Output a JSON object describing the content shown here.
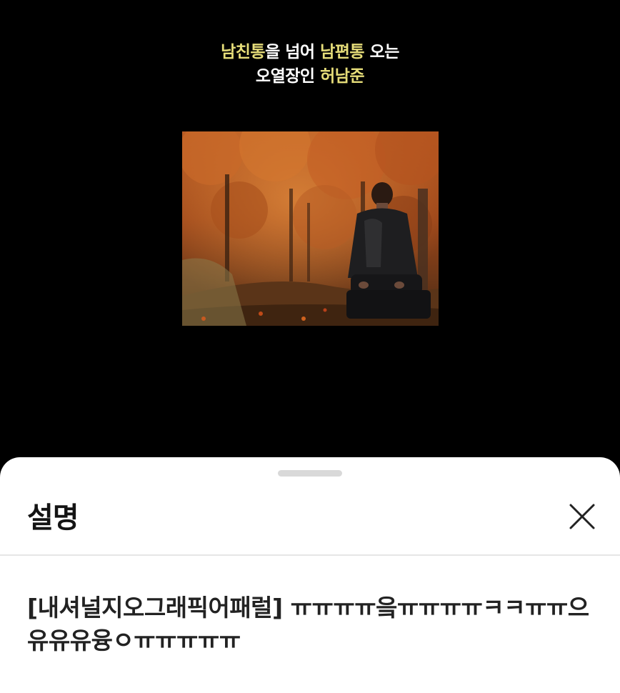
{
  "video": {
    "caption_line1": {
      "hl1": "남친통",
      "mid1": "을 넘어 ",
      "hl2": "남편통",
      "tail": " 오는"
    },
    "caption_line2": {
      "lead": "오열장인 ",
      "hl": "허남준"
    },
    "highlight_color": "#e6dd79"
  },
  "sheet": {
    "title": "설명",
    "close_icon": "close-icon",
    "description": "[내셔널지오그래픽어패럴] ㅠㅠㅠㅠ읔ㅠㅠㅠㅠㅋㅋㅠㅠ으유유유융ㅇㅠㅠㅠㅠㅠ"
  }
}
